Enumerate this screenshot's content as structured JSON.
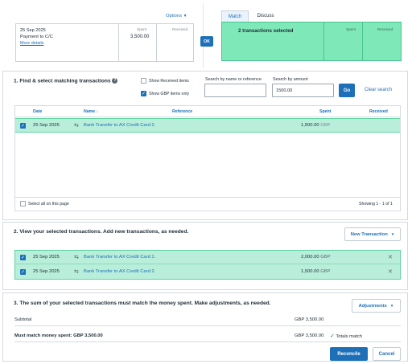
{
  "statement": {
    "options_label": "Options",
    "date": "25 Sep 2025",
    "payee": "Payment to C/C",
    "more_details": "More details",
    "spent_label": "Spent",
    "spent_value": "3,500.00",
    "received_label": "Received",
    "ok_label": "OK"
  },
  "tabs": [
    "Match",
    "Discuss"
  ],
  "selected_panel": {
    "title": "2 transactions selected",
    "spent_label": "Spent",
    "received_label": "Received"
  },
  "find": {
    "title": "1. Find & select matching transactions",
    "show_received": "Show Received items",
    "show_gbp": "Show GBP items only",
    "search_name_label": "Search by name or reference",
    "search_name_value": "",
    "search_amount_label": "Search by amount",
    "search_amount_value": "1500.00",
    "go_label": "Go",
    "clear_label": "Clear search",
    "columns": {
      "date": "Date",
      "name": "Name",
      "sort_arrow": "↓",
      "reference": "Reference",
      "spent": "Spent",
      "received": "Received"
    },
    "rows": [
      {
        "date": "25 Sep 2025",
        "name": "Bank Transfer to AX Credit Card 2.",
        "reference": "",
        "spent": "1,500.00",
        "currency": "GBP",
        "received": ""
      }
    ],
    "select_all": "Select all on this page",
    "showing": "Showing 1 - 1 of 1"
  },
  "view": {
    "title": "2. View your selected transactions. Add new transactions, as needed.",
    "new_transaction": "New Transaction",
    "rows": [
      {
        "date": "25 Sep 2025",
        "name": "Bank Transfer to AX Credit Card 1.",
        "spent": "2,000.00",
        "currency": "GBP"
      },
      {
        "date": "25 Sep 2025",
        "name": "Bank Transfer to AX Credit Card 2.",
        "spent": "1,500.00",
        "currency": "GBP"
      }
    ]
  },
  "sum": {
    "title": "3. The sum of your selected transactions must match the money spent. Make adjustments, as needed.",
    "adjustments": "Adjustments",
    "subtotal_label": "Subtotal",
    "subtotal_value": "GBP 3,500.00",
    "must_match_label": "Must match money spent: GBP 3,500.00",
    "must_match_value": "GBP 3,500.00",
    "totals_match": "Totals match",
    "reconcile": "Reconcile",
    "cancel": "Cancel"
  },
  "colors": {
    "accent": "#1d6fb8",
    "selected_bg": "#b9eedb",
    "match_panel": "#7ee8b8"
  }
}
